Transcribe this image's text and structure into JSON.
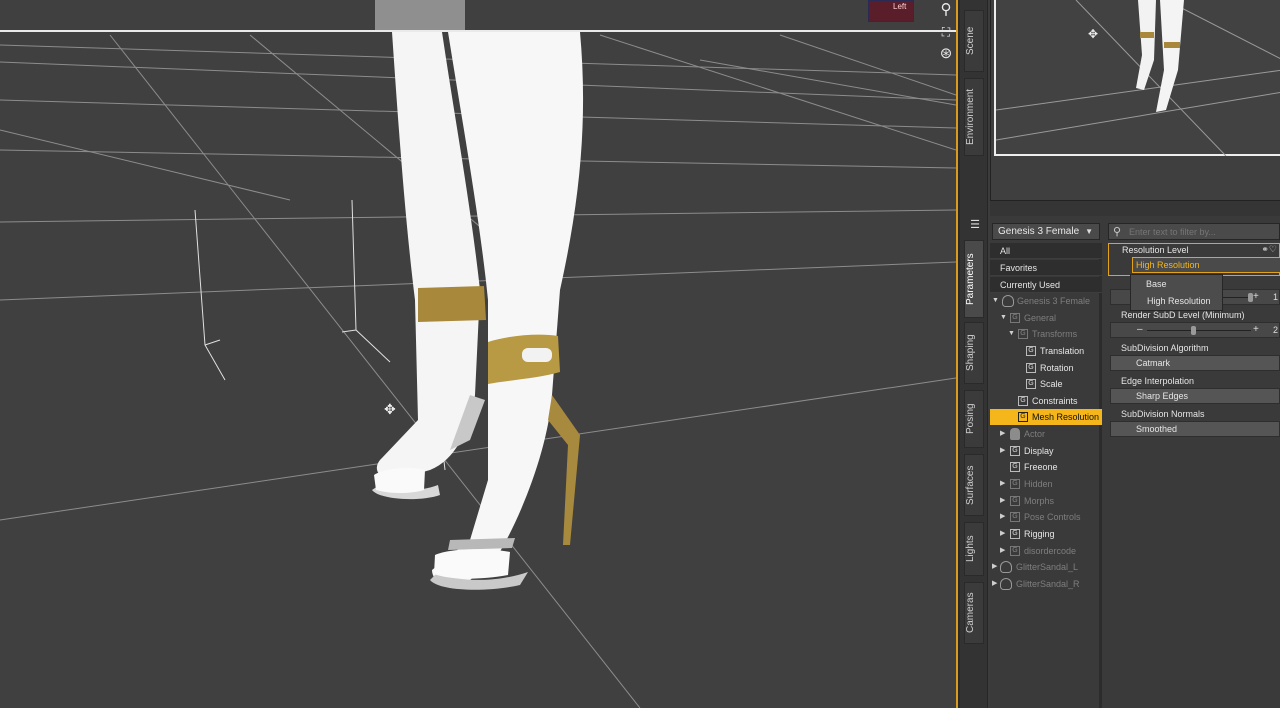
{
  "viewport": {
    "nav_cube_label": "Left",
    "tools": [
      "magnifier-icon",
      "frame-icon",
      "orbit-icon"
    ]
  },
  "side_tabs": [
    "Scene",
    "Environment",
    "Parameters",
    "Shaping",
    "Posing",
    "Surfaces",
    "Lights",
    "Cameras"
  ],
  "active_tab": "Parameters",
  "parameters": {
    "figure_select": "Genesis 3 Female",
    "filter_placeholder": "Enter text to filter by...",
    "categories": [
      "All",
      "Favorites",
      "Currently Used"
    ],
    "tree": [
      {
        "label": "Genesis 3 Female",
        "dim": true
      },
      {
        "label": "General",
        "dim": true
      },
      {
        "label": "Transforms",
        "dim": true
      },
      {
        "label": "Translation",
        "dim": false
      },
      {
        "label": "Rotation",
        "dim": false
      },
      {
        "label": "Scale",
        "dim": false
      },
      {
        "label": "Constraints",
        "dim": false
      },
      {
        "label": "Mesh Resolution",
        "dim": false,
        "selected": true
      },
      {
        "label": "Actor",
        "dim": true
      },
      {
        "label": "Display",
        "dim": false
      },
      {
        "label": "Freeone",
        "dim": false
      },
      {
        "label": "Hidden",
        "dim": true
      },
      {
        "label": "Morphs",
        "dim": true
      },
      {
        "label": "Pose Controls",
        "dim": true
      },
      {
        "label": "Rigging",
        "dim": false
      },
      {
        "label": "disordercode",
        "dim": true
      },
      {
        "label": "GlitterSandal_L",
        "dim": true
      },
      {
        "label": "GlitterSandal_R",
        "dim": true
      }
    ],
    "properties": {
      "resolution_level": {
        "title": "Resolution Level",
        "value": "High Resolution",
        "options": [
          "Base",
          "High Resolution"
        ]
      },
      "subd_level": {
        "value": "1",
        "fraction": 1.0
      },
      "render_subd": {
        "title": "Render SubD Level (Minimum)",
        "value": "2",
        "fraction": 0.45
      },
      "subd_algorithm": {
        "title": "SubDivision Algorithm",
        "value": "Catmark"
      },
      "edge_interp": {
        "title": "Edge Interpolation",
        "value": "Sharp Edges"
      },
      "subd_normals": {
        "title": "SubDivision Normals",
        "value": "Smoothed"
      }
    }
  },
  "colors": {
    "accent": "#f4b61a",
    "viewport_bg": "#404040",
    "panel_bg": "#3a3a3a"
  }
}
